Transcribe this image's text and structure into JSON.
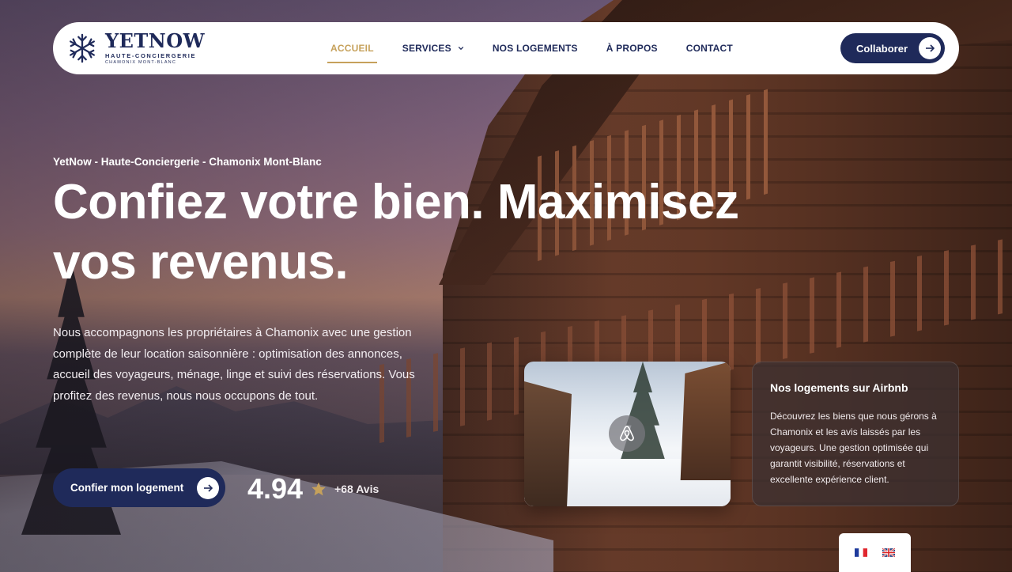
{
  "brand": {
    "name": "YETNOW",
    "tagline": "HAUTE-CONCIERGERIE",
    "location": "CHAMONIX MONT-BLANC",
    "primary_color": "#1f2a5a",
    "accent_color": "#c6a15b"
  },
  "nav": {
    "items": [
      {
        "label": "ACCUEIL",
        "active": true
      },
      {
        "label": "SERVICES",
        "has_dropdown": true
      },
      {
        "label": "NOS LOGEMENTS"
      },
      {
        "label": "À PROPOS"
      },
      {
        "label": "CONTACT"
      }
    ],
    "cta_label": "Collaborer"
  },
  "hero": {
    "eyebrow": "YetNow - Haute-Conciergerie - Chamonix Mont-Blanc",
    "headline": "Confiez votre bien. Maximisez vos revenus.",
    "lead": "Nous accompagnons les propriétaires à Chamonix avec une gestion complète de leur location saisonnière : optimisation des annonces, accueil des voyageurs, ménage, linge et suivi des réservations. Vous profitez des revenus, nous nous occupons de tout.",
    "cta_label": "Confier mon logement",
    "rating": {
      "value": "4.94",
      "reviews": "+68 Avis"
    }
  },
  "airbnb_card": {
    "title": "Nos logements sur Airbnb",
    "text": "Découvrez les biens que nous gérons à Chamonix et les avis laissés par les voyageurs. Une gestion optimisée qui garantit visibilité, réservations et excellente expérience client."
  },
  "languages": [
    {
      "code": "fr",
      "icon": "france-flag-icon"
    },
    {
      "code": "en",
      "icon": "uk-flag-icon"
    }
  ]
}
